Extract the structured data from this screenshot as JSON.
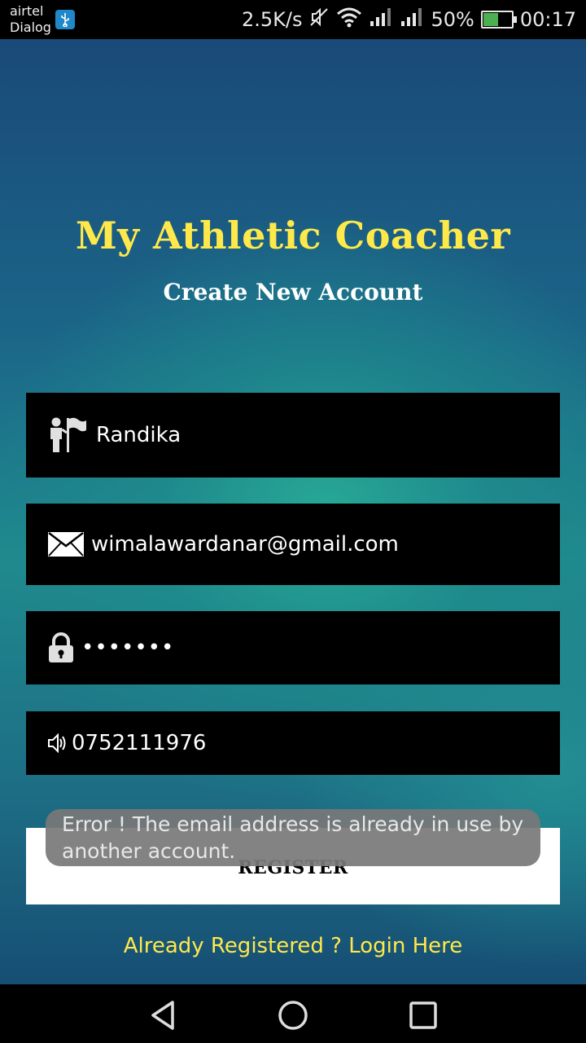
{
  "status_bar": {
    "carrier_line1": "airtel",
    "carrier_line2": "Dialog",
    "speed": "2.5K/s",
    "battery": "50%",
    "time": "00:17"
  },
  "app": {
    "title": "My Athletic Coacher",
    "subtitle": "Create New Account"
  },
  "form": {
    "name_value": "Randika",
    "email_value": "wimalawardanar@gmail.com",
    "password_value": "•••••••",
    "phone_value": "0752111976",
    "register_label": "REGISTER"
  },
  "toast": {
    "message": "Error ! The email address is already in use by another account."
  },
  "login_link": "Already Registered ? Login Here",
  "colors": {
    "title": "#ffe94a",
    "field_bg": "#000000",
    "register_bg": "#ffffff",
    "toast_bg": "#787878"
  },
  "icons": {
    "name": "user-flag-icon",
    "email": "envelope-icon",
    "password": "lock-icon",
    "phone": "speaker-icon"
  }
}
